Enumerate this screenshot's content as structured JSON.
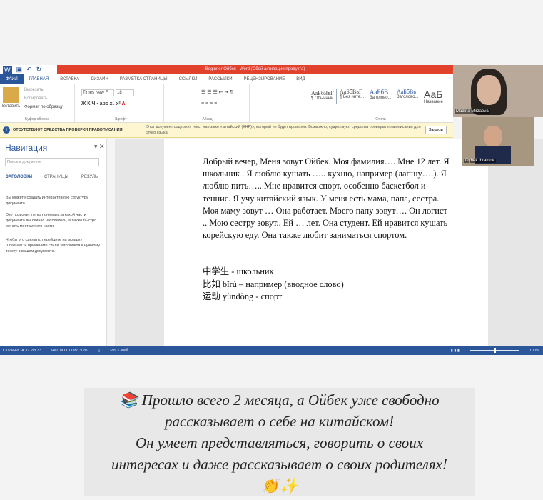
{
  "window": {
    "title": "Beginner Ойбек - Word (Сбой активации продукта)"
  },
  "tabs": [
    "ФАЙЛ",
    "ГЛАВНАЯ",
    "ВСТАВКА",
    "ДИЗАЙН",
    "РАЗМЕТКА СТРАНИЦЫ",
    "ССЫЛКИ",
    "РАССЫЛКИ",
    "РЕЦЕНЗИРОВАНИЕ",
    "ВИД"
  ],
  "ribbon": {
    "paste": "Вставить",
    "cut": "Вырезать",
    "copy": "Копировать",
    "format_painter": "Формат по образцу",
    "clipboard": "Буфер обмена",
    "font_name": "Times New F",
    "font_size": "18",
    "font_group": "Шрифт",
    "paragraph_group": "Абзац",
    "styles_group": "Стили",
    "styles": [
      {
        "sample": "АаБбВвГ",
        "name": "¶ Обычный"
      },
      {
        "sample": "АаБбВвГ",
        "name": "¶ Без инте..."
      },
      {
        "sample": "АаБбВ",
        "name": "Заголово..."
      },
      {
        "sample": "АаБбВв",
        "name": "Заголово..."
      },
      {
        "sample": "АаБ",
        "name": "Название"
      }
    ]
  },
  "warning": {
    "title": "ОТСУТСТВУЮТ СРЕДСТВА ПРОВЕРКИ ПРАВОПИСАНИЯ",
    "message": "Этот документ содержит текст на языке «китайский (КНР)», который не будет проверен. Возможно, существуют средства проверки правописания для этого языка.",
    "button": "Загрузи"
  },
  "navigation": {
    "title": "Навигация",
    "search_placeholder": "Поиск в документе",
    "tabs": [
      "ЗАГОЛОВКИ",
      "СТРАНИЦЫ",
      "РЕЗУЛЬ"
    ],
    "p1": "Вы можете создать интерактивную структуру документа.",
    "p2": "Это позволит легко понимать, в какой части документа вы сейчас находитесь, а также быстро менять местами его части.",
    "p3": "Чтобы это сделать, перейдите на вкладку \"Главная\" и примените стили заголовков к нужному тексту в вашем документе."
  },
  "document": {
    "paragraph": "Добрый вечер, Меня зовут Ойбек. Моя фамилия…. Мне 12 лет. Я школьник . Я люблю кушать ….. кухню, например (лапшу….). Я люблю пить….. Мне нравится спорт, особенно баскетбол и теннис. Я учу китайский язык. У меня есть мама, папа, сестра. Моя маму зовут … Она работает. Моего папу зовут…. Он логист .. Мою сестру зовут.. Ей … лет. Она студент. Ей нравится кушать корейскую еду. Она также любит заниматься спортом.",
    "vocab": [
      "中学生 - школьник",
      "比如 bǐrú – например (вводное слово)",
      "运动 yùndòng  - спорт"
    ]
  },
  "status": {
    "page": "СТРАНИЦА 32 ИЗ 33",
    "words": "ЧИСЛО СЛОВ: 3081",
    "language": "РУССКИЙ",
    "zoom": "100%",
    "zoom_value": 100
  },
  "video": [
    {
      "name": "Madina Mirzaeva"
    },
    {
      "name": "Oybek Ibramov"
    }
  ],
  "caption": {
    "line1": "📚 Прошло всего 2 месяца, а Ойбек уже свободно",
    "line2": "рассказывает о себе на китайском!",
    "line3": "Он умеет представляться, говорить о своих",
    "line4": "интересах и даже рассказывает о своих родителях!",
    "emoji": "👏✨"
  }
}
